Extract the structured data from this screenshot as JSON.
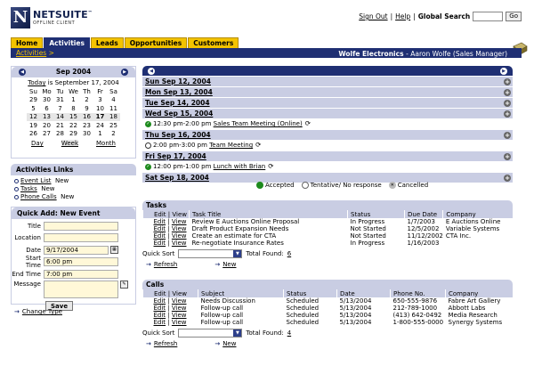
{
  "brand": {
    "name": "NETSUITE",
    "sub": "OFFLINE CLIENT",
    "tm": "™"
  },
  "toplinks": {
    "signout": "Sign Out",
    "sep1": "|",
    "help": "Help",
    "sep2": "|",
    "search_label": "Global Search",
    "go": "Go"
  },
  "tabs": [
    "Home",
    "Activities",
    "Leads",
    "Opportunities",
    "Customers"
  ],
  "breadcrumb": {
    "link": "Activities",
    "sep": ">"
  },
  "company": {
    "name": "Wolfe Electronics",
    "user": "- Aaron Wolfe (Sales Manager)"
  },
  "calendar": {
    "month": "Sep 2004",
    "today_link": "Today",
    "today_text": "is September 17, 2004",
    "weekdays": [
      "Su",
      "Mo",
      "Tu",
      "We",
      "Th",
      "Fr",
      "Sa"
    ],
    "weeks": [
      [
        "29",
        "30",
        "31",
        "1",
        "2",
        "3",
        "4"
      ],
      [
        "5",
        "6",
        "7",
        "8",
        "9",
        "10",
        "11"
      ],
      [
        "12",
        "13",
        "14",
        "15",
        "16",
        "17",
        "18"
      ],
      [
        "19",
        "20",
        "21",
        "22",
        "23",
        "24",
        "25"
      ],
      [
        "26",
        "27",
        "28",
        "29",
        "30",
        "1",
        "2"
      ]
    ],
    "views": [
      "Day",
      "Week",
      "Month"
    ]
  },
  "activities_links": {
    "title": "Activities Links",
    "items": [
      {
        "label": "Event List",
        "extra": "New"
      },
      {
        "label": "Tasks",
        "extra": "New"
      },
      {
        "label": "Phone Calls",
        "extra": "New"
      }
    ]
  },
  "quick_add": {
    "title": "Quick Add: New Event",
    "title_label": "Title",
    "location_label": "Location",
    "date_label": "Date",
    "date_value": "9/17/2004",
    "start_label": "Start Time",
    "start_value": "6:00 pm",
    "end_label": "End Time",
    "end_value": "7:00 pm",
    "message_label": "Message",
    "save": "Save",
    "change_type": "Change Type"
  },
  "week": {
    "days": [
      {
        "label": "Sun Sep 12, 2004",
        "events": []
      },
      {
        "label": "Mon Sep 13, 2004",
        "events": []
      },
      {
        "label": "Tue Sep 14, 2004",
        "events": []
      },
      {
        "label": "Wed Sep 15, 2004",
        "events": [
          {
            "time": "12:30 pm-2:00 pm",
            "title": "Sales Team Meeting (Online)",
            "status": "accepted"
          }
        ]
      },
      {
        "label": "Thu Sep 16, 2004",
        "events": [
          {
            "time": "2:00 pm-3:00 pm",
            "title": "Team Meeting",
            "status": "tentative"
          }
        ]
      },
      {
        "label": "Fri Sep 17, 2004",
        "events": [
          {
            "time": "12:00 pm-1:00 pm",
            "title": "Lunch with Brian",
            "status": "accepted"
          }
        ]
      },
      {
        "label": "Sat Sep 18, 2004",
        "events": []
      }
    ],
    "legend": {
      "accepted": "Accepted",
      "tentative": "Tentative/ No response",
      "cancelled": "Cancelled"
    }
  },
  "tasks": {
    "title": "Tasks",
    "headers": [
      "Edit | View",
      "Task Title",
      "Status",
      "Due Date",
      "Company"
    ],
    "rows": [
      [
        "Review E Auctions Online Proposal",
        "In Progress",
        "1/7/2003",
        "E Auctions Online"
      ],
      [
        "Draft Product Expansion Needs",
        "Not Started",
        "12/5/2002",
        "Variable Systems"
      ],
      [
        "Create an estimate for CTA",
        "Not Started",
        "11/12/2002",
        "CTA Inc."
      ],
      [
        "Re-negotiate Insurance Rates",
        "In Progress",
        "1/16/2003",
        ""
      ]
    ],
    "quick_sort": "Quick Sort",
    "total_label": "Total Found:",
    "total": "6",
    "refresh": "Refresh",
    "new": "New"
  },
  "calls": {
    "title": "Calls",
    "headers": [
      "Edit | View",
      "Subject",
      "Status",
      "Date",
      "Phone No.",
      "Company"
    ],
    "rows": [
      [
        "Needs Discussion",
        "Scheduled",
        "5/13/2004",
        "650-555-9876",
        "Fabre Art Gallery"
      ],
      [
        "Follow-up call",
        "Scheduled",
        "5/13/2004",
        "212-789-1000",
        "Abbott Labs"
      ],
      [
        "Follow-up call",
        "Scheduled",
        "5/13/2004",
        "(413) 642-0492",
        "Media Research"
      ],
      [
        "Follow-up call",
        "Scheduled",
        "5/13/2004",
        "1-800-555-0000",
        "Synergy Systems"
      ]
    ],
    "quick_sort": "Quick Sort",
    "total_label": "Total Found:",
    "total": "4",
    "refresh": "Refresh",
    "new": "New"
  },
  "edit": "Edit",
  "view": "View",
  "pipe": "|",
  "colors": {
    "navy": "#1f2f73",
    "tab_yellow": "#f3c300",
    "panel": "#c9cde3",
    "accepted": "#1d8a1d"
  }
}
